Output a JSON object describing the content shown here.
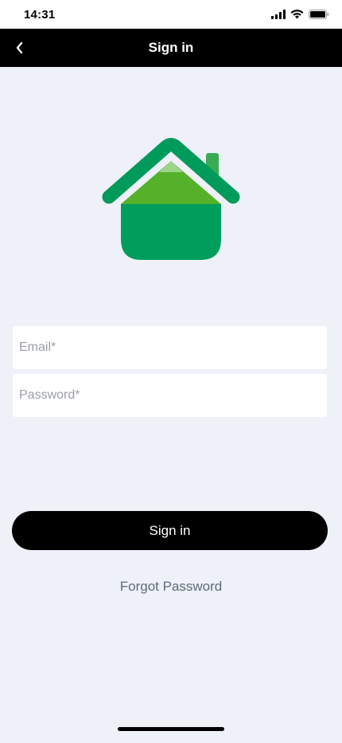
{
  "status_bar": {
    "time": "14:31",
    "icons": [
      "cellular-signal-icon",
      "wifi-icon",
      "battery-icon"
    ]
  },
  "nav": {
    "title": "Sign in",
    "back_icon": "chevron-left-icon"
  },
  "logo": {
    "icon": "house-logo-icon",
    "colors": {
      "roof": "#009a5b",
      "light_green": "#55b02a",
      "pale": "#9ed48a",
      "body": "#009e5c"
    }
  },
  "form": {
    "email_placeholder": "Email*",
    "password_placeholder": "Password*",
    "email_value": "",
    "password_value": ""
  },
  "actions": {
    "sign_in_label": "Sign in",
    "forgot_password_label": "Forgot Password"
  },
  "colors": {
    "background": "#eef1f8",
    "nav_background": "#000000",
    "button_background": "#000000",
    "link_color": "#5e6a7d"
  }
}
